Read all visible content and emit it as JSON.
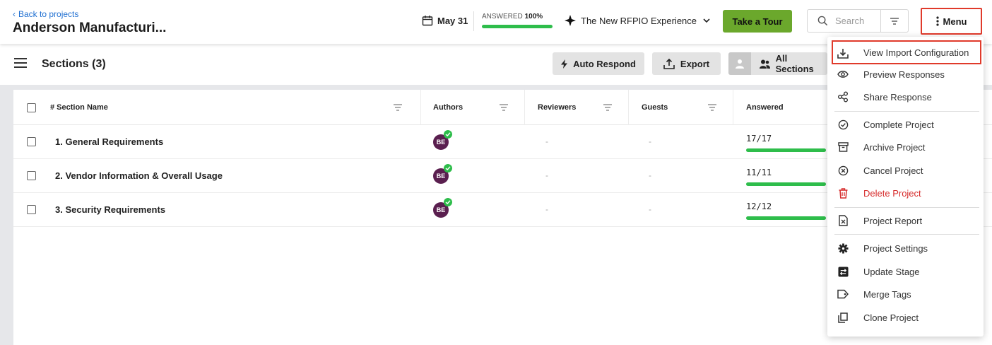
{
  "header": {
    "back_label": "Back to projects",
    "project_title": "Anderson Manufacturi...",
    "due_date": "May 31",
    "answered_label": "ANSWERED",
    "answered_value": "100%",
    "answered_progress": 1.0,
    "workspace_label": "The New RFPIO Experience",
    "tour_label": "Take a Tour",
    "search_placeholder": "Search",
    "menu_label": "Menu"
  },
  "toolbar": {
    "sections_title": "Sections (3)",
    "auto_respond_label": "Auto Respond",
    "export_label": "Export",
    "all_sections_label": "All Sections"
  },
  "table": {
    "columns": [
      "# Section Name",
      "Authors",
      "Reviewers",
      "Guests",
      "Answered"
    ],
    "rows": [
      {
        "name": "1. General Requirements",
        "author_initials": "BE",
        "reviewers": "-",
        "guests": "-",
        "answered": "17/17",
        "progress": 1.0
      },
      {
        "name": "2. Vendor Information & Overall Usage",
        "author_initials": "BE",
        "reviewers": "-",
        "guests": "-",
        "answered": "11/11",
        "progress": 1.0
      },
      {
        "name": "3. Security Requirements",
        "author_initials": "BE",
        "reviewers": "-",
        "guests": "-",
        "answered": "12/12",
        "progress": 1.0
      }
    ]
  },
  "menu": {
    "items": [
      {
        "label": "View Import Configuration",
        "icon": "download-icon"
      },
      {
        "label": "Preview Responses",
        "icon": "eye-icon"
      },
      {
        "label": "Share Response",
        "icon": "share-icon"
      },
      {
        "label": "Complete Project",
        "icon": "check-circle-icon"
      },
      {
        "label": "Archive Project",
        "icon": "archive-icon"
      },
      {
        "label": "Cancel Project",
        "icon": "cancel-circle-icon"
      },
      {
        "label": "Delete Project",
        "icon": "trash-icon"
      },
      {
        "label": "Project Report",
        "icon": "report-file-icon"
      },
      {
        "label": "Project Settings",
        "icon": "gear-icon"
      },
      {
        "label": "Update Stage",
        "icon": "stage-icon"
      },
      {
        "label": "Merge Tags",
        "icon": "tag-icon"
      },
      {
        "label": "Clone Project",
        "icon": "copy-icon"
      }
    ]
  },
  "colors": {
    "accent_green": "#6ba82c",
    "progress_green": "#2ebd4b",
    "highlight_red": "#e03a2b",
    "danger_red": "#d62b2b",
    "link_blue": "#1f6fd1",
    "avatar_purple": "#5a1f4f"
  }
}
